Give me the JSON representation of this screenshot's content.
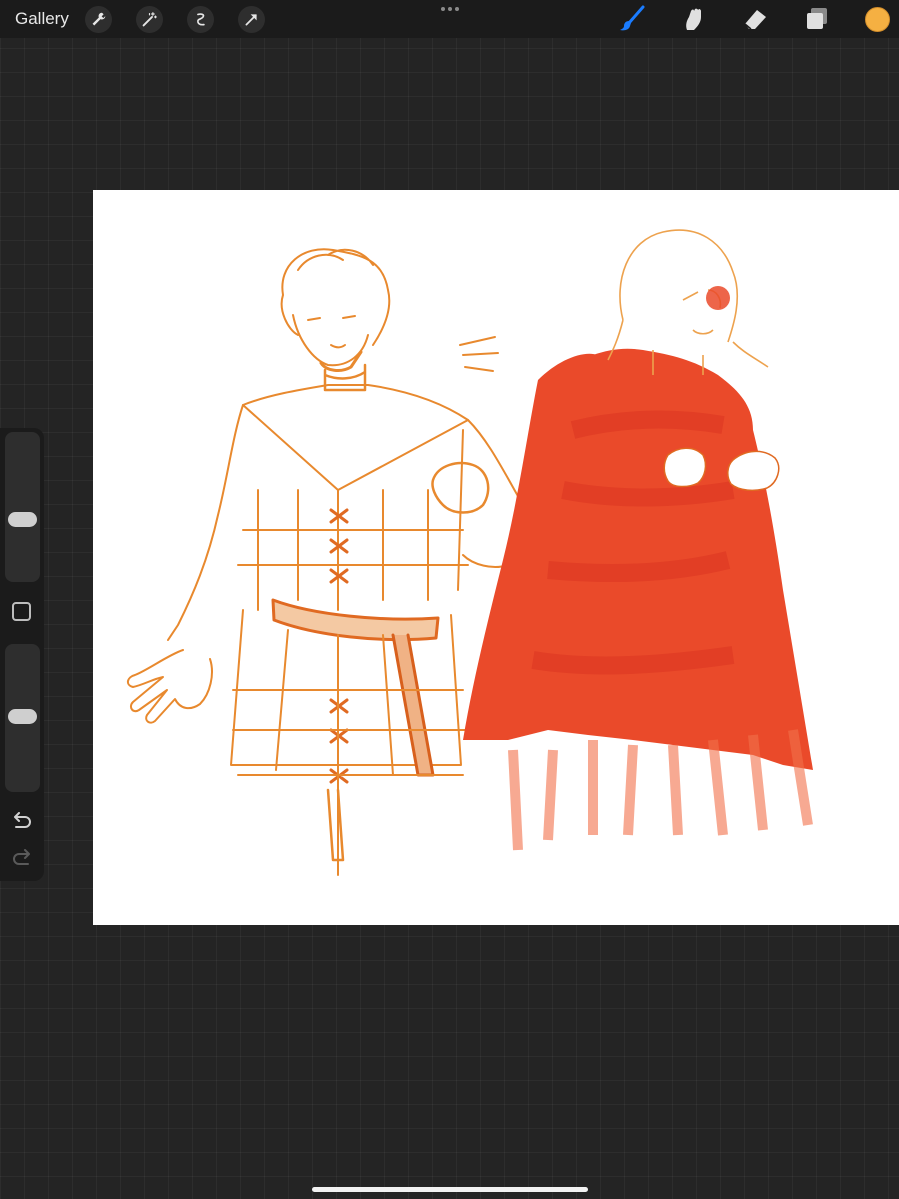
{
  "topbar": {
    "gallery_label": "Gallery",
    "left_tools": [
      "wrench-icon",
      "magic-wand-icon",
      "selection-icon",
      "transform-arrow-icon"
    ],
    "right_tools": [
      "brush-icon",
      "smudge-icon",
      "eraser-icon",
      "layers-icon"
    ],
    "active_tool": "brush-icon",
    "active_color": "#f5b042",
    "accent_color": "#1a7cff"
  },
  "sidebar": {
    "brush_size_level": 0.5,
    "opacity_level": 0.5,
    "controls": [
      "brush-size-slider",
      "modify-button",
      "opacity-slider",
      "undo-icon",
      "redo-icon"
    ]
  },
  "canvas": {
    "background": "#ffffff",
    "stroke_color": "#e8892e",
    "cape_color": "#ea4a2a"
  }
}
